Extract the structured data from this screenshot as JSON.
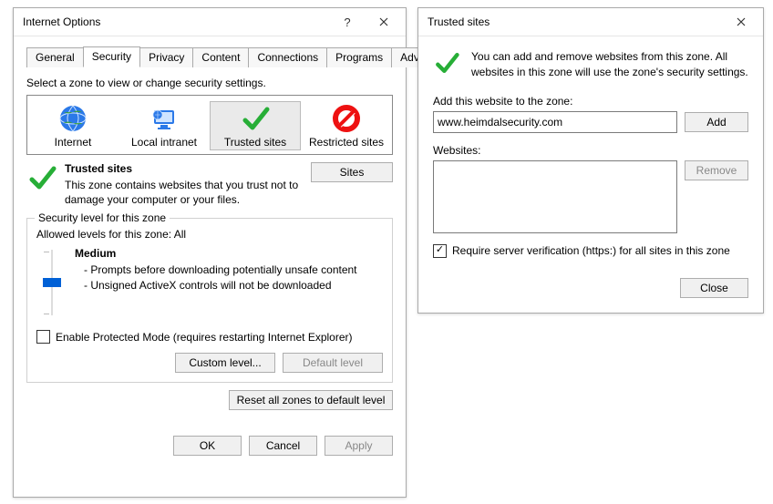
{
  "internetOptions": {
    "title": "Internet Options",
    "tabs": [
      "General",
      "Security",
      "Privacy",
      "Content",
      "Connections",
      "Programs",
      "Advanced"
    ],
    "activeTab": "Security",
    "zoneInstruction": "Select a zone to view or change security settings.",
    "zones": [
      {
        "label": "Internet"
      },
      {
        "label": "Local intranet"
      },
      {
        "label": "Trusted sites"
      },
      {
        "label": "Restricted sites"
      }
    ],
    "selectedZoneIndex": 2,
    "trusted": {
      "title": "Trusted sites",
      "desc": "This zone contains websites that you trust not to damage your computer or your files.",
      "sitesBtn": "Sites"
    },
    "group": {
      "legend": "Security level for this zone",
      "allowed": "Allowed levels for this zone: All",
      "level": "Medium",
      "bullet1": "- Prompts before downloading potentially unsafe content",
      "bullet2": "- Unsigned ActiveX controls will not be downloaded",
      "protectedMode": "Enable Protected Mode (requires restarting Internet Explorer)",
      "customBtn": "Custom level...",
      "defaultBtn": "Default level",
      "resetBtn": "Reset all zones to default level"
    },
    "footer": {
      "ok": "OK",
      "cancel": "Cancel",
      "apply": "Apply"
    }
  },
  "trustedSites": {
    "title": "Trusted sites",
    "info": "You can add and remove websites from this zone. All websites in this zone will use the zone's security settings.",
    "addLabel": "Add this website to the zone:",
    "inputValue": "www.heimdalsecurity.com",
    "addBtn": "Add",
    "websitesLabel": "Websites:",
    "removeBtn": "Remove",
    "requireHttps": "Require server verification (https:) for all sites in this zone",
    "closeBtn": "Close"
  }
}
